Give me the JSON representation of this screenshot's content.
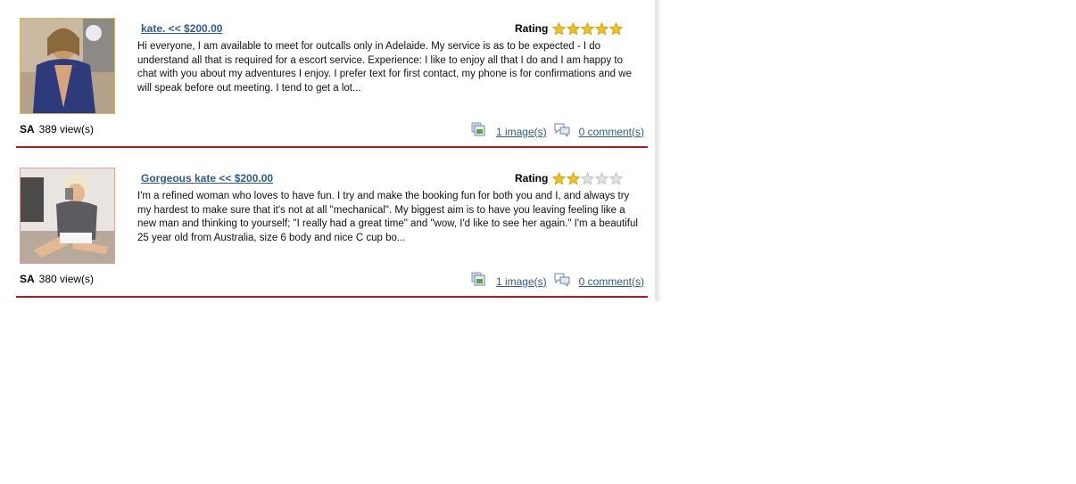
{
  "listings": [
    {
      "title": "kate. << $200.00",
      "rating_label": "Rating",
      "rating": 5,
      "rating_max": 5,
      "description": "Hi everyone, I am available to meet for outcalls only in Adelaide. My service is as to be expected - I do understand all that is required for a escort service. Experience: I like to enjoy all that I do and I am happy to chat with you about my adventures I enjoy. I prefer text for first contact, my phone is for confirmations and we will speak before out meeting. I tend to get a lot...",
      "state": "SA",
      "views": "389 view(s)",
      "images_link": "1 image(s)",
      "comments_link": "0 comment(s)"
    },
    {
      "title": "Gorgeous kate << $200.00",
      "rating_label": "Rating",
      "rating": 2,
      "rating_max": 5,
      "description": "I'm a refined woman who loves to have fun. I try and make the booking fun for both you and I, and always try my hardest to make sure that it's not at all \"mechanical\". My biggest aim is to have you leaving feeling like a new man and thinking to yourself; \"I really had a great time\" and \"wow, I'd like to see her again.\" I'm a beautiful 25 year old from Australia, size 6 body and nice C cup bo...",
      "state": "SA",
      "views": "380 view(s)",
      "images_link": "1 image(s)",
      "comments_link": "0 comment(s)"
    }
  ],
  "icons": {
    "star_filled": "star-filled-icon",
    "star_empty": "star-empty-icon",
    "images": "image-gallery-icon",
    "comments": "comment-bubbles-icon"
  },
  "colors": {
    "link": "#2f5a8a",
    "divider": "#b01c1c",
    "star_fill": "#f2c218",
    "star_empty": "#e2e2e2"
  }
}
